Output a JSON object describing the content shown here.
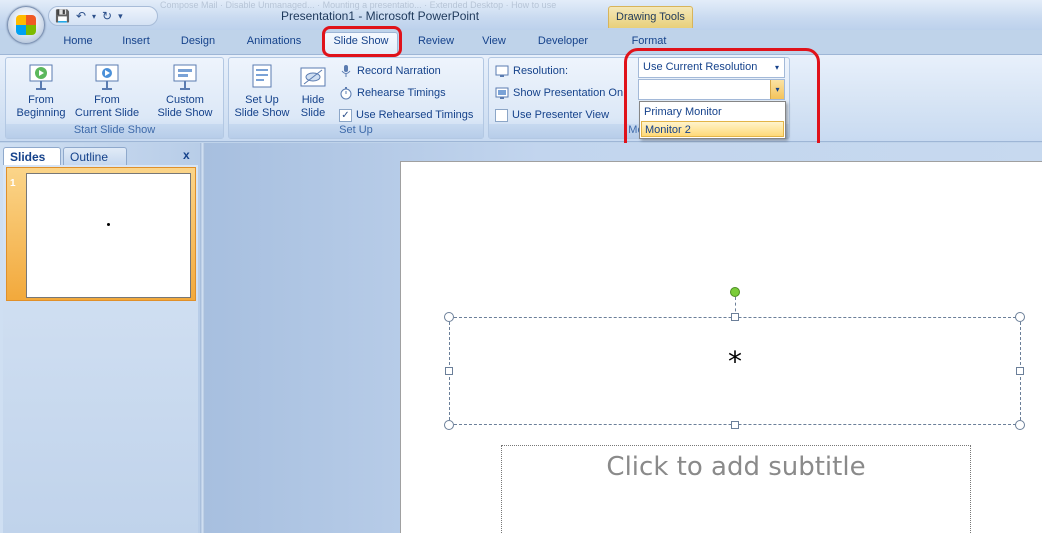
{
  "window": {
    "title": "Presentation1 - Microsoft PowerPoint",
    "context_tab": "Drawing Tools",
    "background_tabs_text": "Compose Mail · Disable Unmanaged... · Mounting a presentatio... · Extended Desktop · How to use"
  },
  "tabs": [
    "Home",
    "Insert",
    "Design",
    "Animations",
    "Slide Show",
    "Review",
    "View",
    "Developer",
    "Format"
  ],
  "active_tab": "Slide Show",
  "ribbon": {
    "start_group": {
      "label": "Start Slide Show",
      "from_beginning": "From\nBeginning",
      "from_current": "From\nCurrent Slide",
      "custom": "Custom\nSlide Show"
    },
    "setup_group": {
      "label": "Set Up",
      "setup_show": "Set Up\nSlide Show",
      "hide_slide": "Hide\nSlide",
      "record_narration": "Record Narration",
      "rehearse_timings": "Rehearse Timings",
      "use_rehearsed": "Use Rehearsed Timings"
    },
    "monitors_group": {
      "label": "Mon",
      "resolution_label": "Resolution:",
      "resolution_value": "Use Current Resolution",
      "show_on_label": "Show Presentation On:",
      "show_on_value": "",
      "presenter_view": "Use Presenter View"
    }
  },
  "dropdown": {
    "items": [
      "Primary Monitor",
      "Monitor 2"
    ],
    "selected": "Monitor 2"
  },
  "left_panel": {
    "tab_slides": "Slides",
    "tab_outline": "Outline",
    "close": "x",
    "slide_number": "1"
  },
  "slide": {
    "title_text": "*",
    "subtitle_placeholder": "Click to add subtitle"
  },
  "colors": {
    "highlight": "#e0121a",
    "selection": "#f2a93c",
    "rotation_handle": "#7acc3a"
  }
}
